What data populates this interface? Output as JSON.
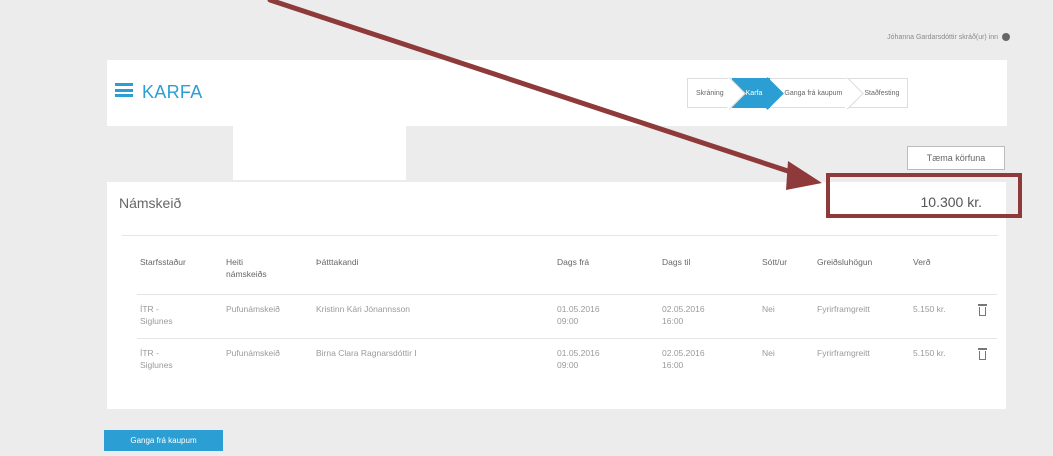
{
  "header": {
    "user_link": "Jóhanna Gardarsdóttir skráð(ur) inn",
    "cart_title": "KARFA",
    "steps": [
      {
        "label": "Skráning",
        "active": false
      },
      {
        "label": "Karfa",
        "active": true
      },
      {
        "label": "Ganga frá kaupum",
        "active": false
      },
      {
        "label": "Staðfesting",
        "active": false
      }
    ]
  },
  "actions": {
    "empty_cart_label": "Tæma körfuna",
    "checkout_label": "Ganga frá kaupum"
  },
  "courses": {
    "title": "Námskeið",
    "total": "10.300 kr.",
    "columns": [
      "Starfsstaður",
      "Heiti námskeiðs",
      "Þátttakandi",
      "Dags frá",
      "Dags til",
      "Sótt/ur",
      "Greiðsluhögun",
      "Verð"
    ],
    "rows": [
      {
        "location": "ÍTR - Siglunes",
        "course": "Pufunámskeið",
        "participant": "Kristinn Kári Jónannsson",
        "date_from": "01.05.2016 09:00",
        "date_to": "02.05.2016 16:00",
        "collected": "Nei",
        "payment": "Fyrirframgreitt",
        "price": "5.150 kr."
      },
      {
        "location": "ÍTR - Siglunes",
        "course": "Pufunámskeið",
        "participant": "Birna Clara Ragnarsdóttir I",
        "date_from": "01.05.2016 09:00",
        "date_to": "02.05.2016 16:00",
        "collected": "Nei",
        "payment": "Fyrirframgreitt",
        "price": "5.150 kr."
      }
    ]
  },
  "colors": {
    "accent": "#2b9fd3",
    "annotation": "#8f3a3a",
    "background": "#ececec"
  }
}
